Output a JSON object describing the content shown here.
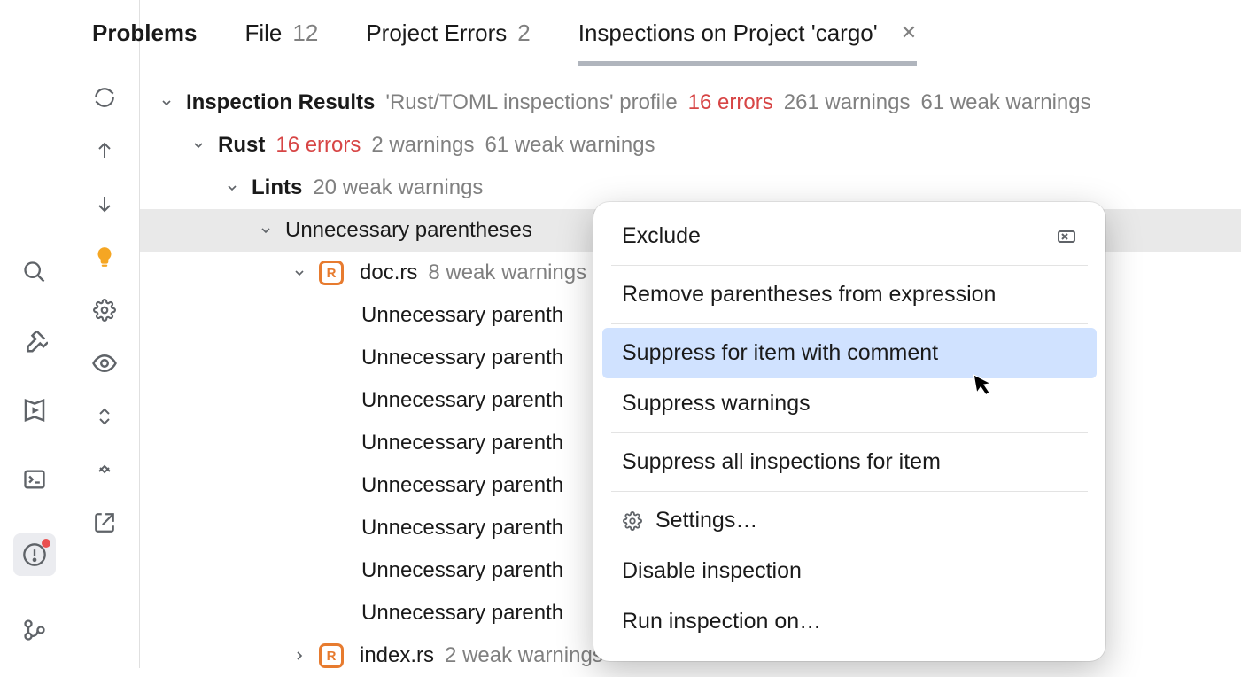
{
  "tabs": {
    "problems": "Problems",
    "file": {
      "label": "File",
      "count": "12"
    },
    "project_errors": {
      "label": "Project Errors",
      "count": "2"
    },
    "inspections": {
      "label": "Inspections on Project 'cargo'"
    }
  },
  "results": {
    "title": "Inspection Results",
    "profile": "'Rust/TOML inspections' profile",
    "errors": "16 errors",
    "warnings": "261 warnings",
    "weak": "61 weak warnings"
  },
  "rust": {
    "label": "Rust",
    "errors": "16 errors",
    "warnings": "2 warnings",
    "weak": "61 weak warnings"
  },
  "lints": {
    "label": "Lints",
    "weak": "20 weak warnings"
  },
  "unnecessary": "Unnecessary parentheses",
  "doc": {
    "name": "doc.rs",
    "weak": "8 weak warnings"
  },
  "paren_item": "Unnecessary parenth",
  "index": {
    "name": "index.rs",
    "weak": "2 weak warnings"
  },
  "menu": {
    "exclude": "Exclude",
    "remove": "Remove parentheses from expression",
    "suppress_item": "Suppress for item with comment",
    "suppress_warn": "Suppress warnings",
    "suppress_all": "Suppress all inspections for item",
    "settings": "Settings…",
    "disable": "Disable inspection",
    "run": "Run inspection on…"
  }
}
